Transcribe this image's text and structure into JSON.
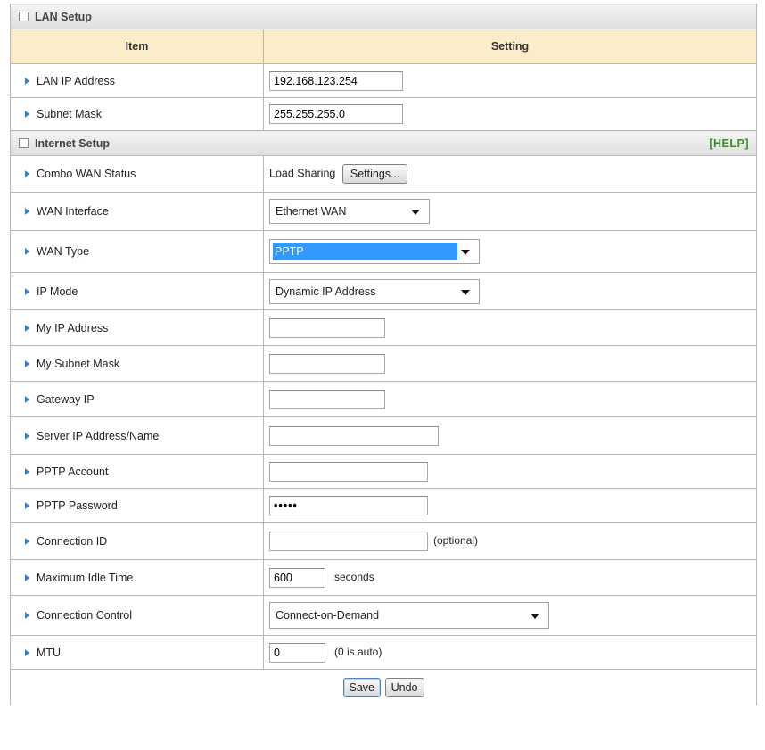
{
  "lan": {
    "title": "LAN Setup",
    "col_item": "Item",
    "col_setting": "Setting",
    "ip_label": "LAN IP Address",
    "ip_value": "192.168.123.254",
    "mask_label": "Subnet Mask",
    "mask_value": "255.255.255.0"
  },
  "internet": {
    "title": "Internet Setup",
    "help": "[HELP]",
    "combo_label": "Combo WAN Status",
    "combo_value": "Load Sharing",
    "settings_button": "Settings...",
    "wan_if_label": "WAN Interface",
    "wan_if_value": "Ethernet WAN",
    "wan_type_label": "WAN Type",
    "wan_type_value": "PPTP",
    "ip_mode_label": "IP Mode",
    "ip_mode_value": "Dynamic IP Address",
    "my_ip_label": "My IP Address",
    "my_ip_value": "",
    "my_mask_label": "My Subnet Mask",
    "my_mask_value": "",
    "gateway_label": "Gateway IP",
    "gateway_value": "",
    "server_label": "Server IP Address/Name",
    "server_value": "",
    "account_label": "PPTP Account",
    "account_value": "",
    "password_label": "PPTP Password",
    "password_value": "•••••",
    "conn_id_label": "Connection ID",
    "conn_id_value": "",
    "conn_id_note": "(optional)",
    "idle_label": "Maximum Idle Time",
    "idle_value": "600",
    "idle_unit": "seconds",
    "control_label": "Connection Control",
    "control_value": "Connect-on-Demand",
    "mtu_label": "MTU",
    "mtu_value": "0",
    "mtu_note": "(0 is auto)"
  },
  "footer": {
    "save": "Save",
    "undo": "Undo"
  },
  "colors": {
    "section_bg": "#e6e6e6",
    "header_bg": "#fbedc9",
    "help_text": "#3b8a2c",
    "bullet": "#3c7fc1",
    "selection": "#3399ff"
  }
}
